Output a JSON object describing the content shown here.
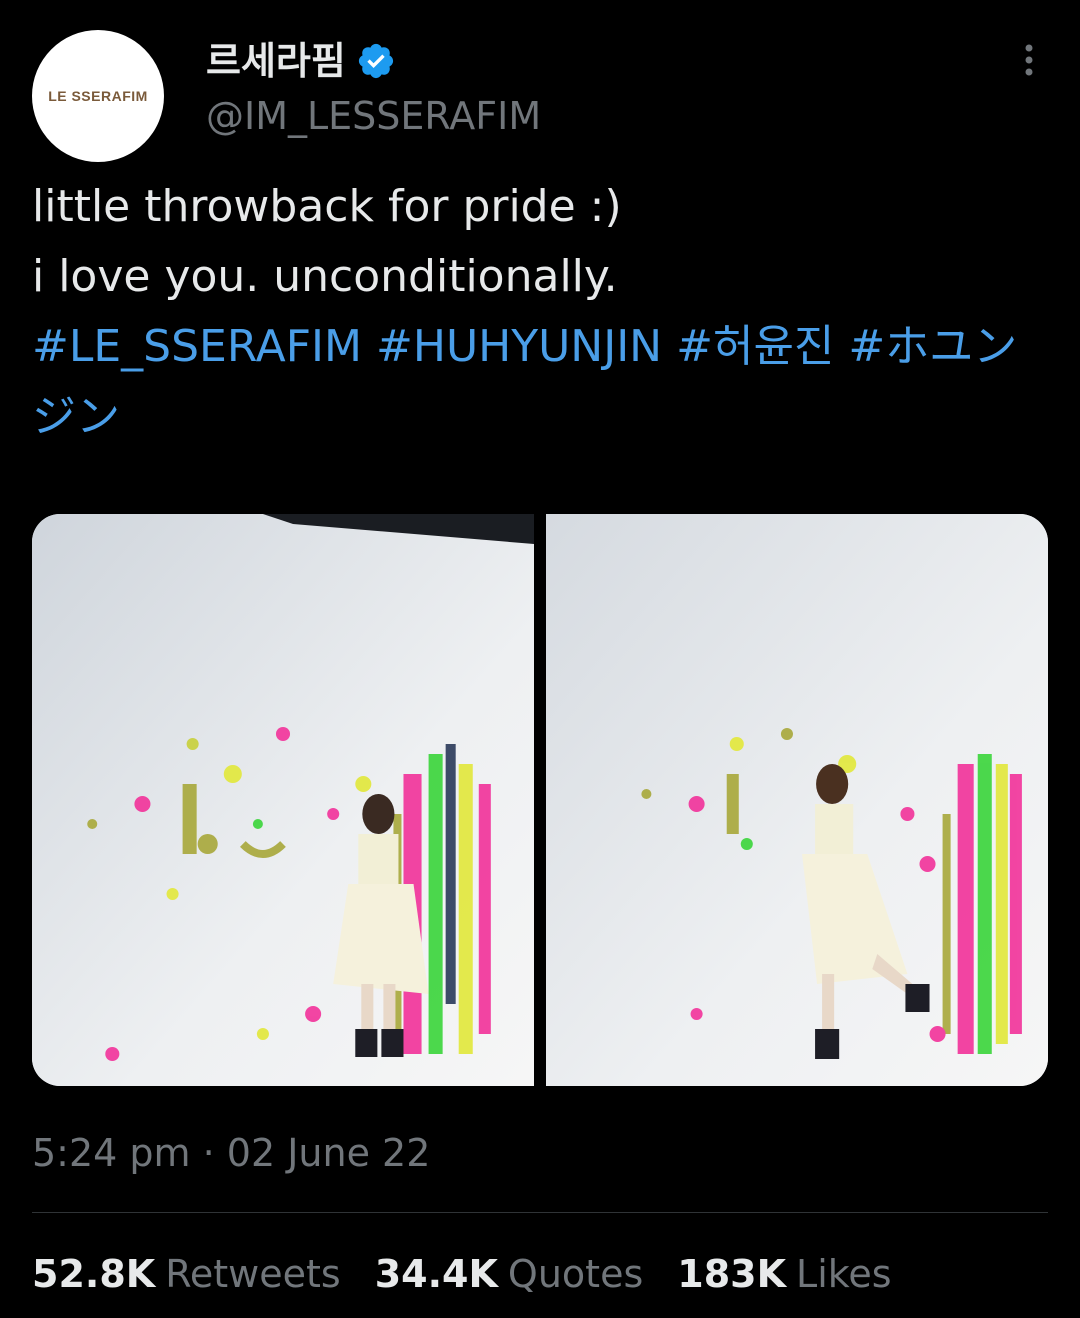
{
  "header": {
    "avatar_text": "LE SSERAFIM",
    "display_name": "르세라핌",
    "handle": "@IM_LESSERAFIM"
  },
  "tweet": {
    "line1": "little throwback for pride :)",
    "line2": "i love you. unconditionally.",
    "hashtags": [
      "#LE_SSERAFIM",
      "#HUHYUNJIN",
      "#허윤진",
      "#ホユンジン"
    ]
  },
  "media": {
    "photos": [
      "photo-1",
      "photo-2"
    ]
  },
  "timestamp": "5:24 pm · 02 June 22",
  "stats": {
    "retweets_count": "52.8K",
    "retweets_label": "Retweets",
    "quotes_count": "34.4K",
    "quotes_label": "Quotes",
    "likes_count": "183K",
    "likes_label": "Likes"
  },
  "colors": {
    "background": "#000000",
    "text": "#e7e9ea",
    "secondary": "#71767b",
    "hashtag": "#4a9ee8",
    "verified": "#1d9bf0"
  }
}
